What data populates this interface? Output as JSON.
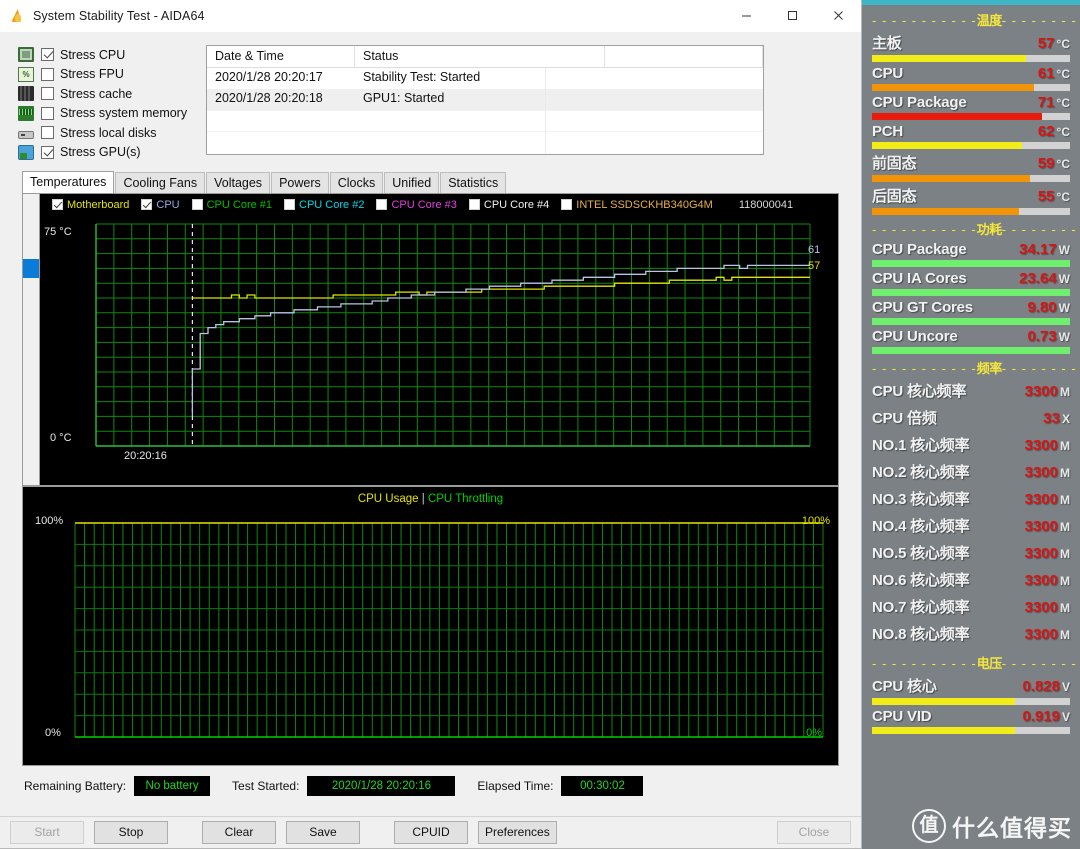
{
  "window": {
    "title": "System Stability Test - AIDA64",
    "icon": "flame-icon",
    "minimize_label": "minimize-icon",
    "maximize_label": "maximize-icon",
    "close_label": "close-icon"
  },
  "stress_options": [
    {
      "label": "Stress CPU",
      "checked": true,
      "icon": "cpu-chip-icon"
    },
    {
      "label": "Stress FPU",
      "checked": false,
      "icon": "fpu-percent-icon"
    },
    {
      "label": "Stress cache",
      "checked": false,
      "icon": "cache-icon"
    },
    {
      "label": "Stress system memory",
      "checked": false,
      "icon": "memory-stick-icon"
    },
    {
      "label": "Stress local disks",
      "checked": false,
      "icon": "hard-disk-icon"
    },
    {
      "label": "Stress GPU(s)",
      "checked": true,
      "icon": "gpu-card-icon"
    }
  ],
  "log_table": {
    "headers": [
      "Date & Time",
      "Status",
      ""
    ],
    "rows": [
      {
        "datetime": "2020/1/28 20:20:17",
        "status": "Stability Test: Started"
      },
      {
        "datetime": "2020/1/28 20:20:18",
        "status": "GPU1: Started"
      }
    ]
  },
  "tabs": [
    {
      "label": "Temperatures",
      "active": true
    },
    {
      "label": "Cooling Fans",
      "active": false
    },
    {
      "label": "Voltages",
      "active": false
    },
    {
      "label": "Powers",
      "active": false
    },
    {
      "label": "Clocks",
      "active": false
    },
    {
      "label": "Unified",
      "active": false
    },
    {
      "label": "Statistics",
      "active": false
    }
  ],
  "temp_chart": {
    "legend": [
      {
        "label": "Motherboard",
        "checked": true,
        "color": "#e3e300"
      },
      {
        "label": "CPU",
        "checked": true,
        "color": "#9aa6e0"
      },
      {
        "label": "CPU Core #1",
        "checked": false,
        "color": "#00c000"
      },
      {
        "label": "CPU Core #2",
        "checked": false,
        "color": "#00d8e8"
      },
      {
        "label": "CPU Core #3",
        "checked": false,
        "color": "#e040e0"
      },
      {
        "label": "CPU Core #4",
        "checked": false,
        "color": "#f0f0f0"
      },
      {
        "label": "INTEL SSDSCKHB340G4M",
        "checked": false,
        "color": "#e8b04a"
      }
    ],
    "serial": "118000041",
    "y_top": "75 °C",
    "y_bottom": "0 °C",
    "x_start": "20:20:16",
    "value_labels": [
      {
        "text": "61",
        "color": "#b9c3e6"
      },
      {
        "text": "57",
        "color": "#e3e300"
      }
    ]
  },
  "usage_chart": {
    "title_a": "CPU Usage",
    "title_sep": "|",
    "title_b": "CPU Throttling",
    "y_top_left": "100%",
    "y_top_right": "100%",
    "y_bottom_left": "0%",
    "y_bottom_right": "0%"
  },
  "status": {
    "battery_label": "Remaining Battery:",
    "battery_value": "No battery",
    "started_label": "Test Started:",
    "started_value": "2020/1/28 20:20:16",
    "elapsed_label": "Elapsed Time:",
    "elapsed_value": "00:30:02"
  },
  "buttons": [
    {
      "label": "Start",
      "disabled": true
    },
    {
      "label": "Stop",
      "disabled": false
    },
    {
      "label": "Clear",
      "disabled": false
    },
    {
      "label": "Save",
      "disabled": false
    },
    {
      "label": "CPUID",
      "disabled": false
    },
    {
      "label": "Preferences",
      "disabled": false
    },
    {
      "label": "Close",
      "disabled": true
    }
  ],
  "sidebar": {
    "sections": [
      {
        "title": "温度",
        "metrics": [
          {
            "name": "主板",
            "value": "57",
            "unit": "°C",
            "bar": 78,
            "color": "#f2ec19"
          },
          {
            "name": "CPU",
            "value": "61",
            "unit": "°C",
            "bar": 82,
            "color": "#f29407"
          },
          {
            "name": "CPU Package",
            "value": "71",
            "unit": "°C",
            "bar": 86,
            "color": "#e81b0d"
          },
          {
            "name": "PCH",
            "value": "62",
            "unit": "°C",
            "bar": 76,
            "color": "#f2ec19"
          },
          {
            "name": "前固态",
            "value": "59",
            "unit": "°C",
            "bar": 80,
            "color": "#f29407"
          },
          {
            "name": "后固态",
            "value": "55",
            "unit": "°C",
            "bar": 74,
            "color": "#f29407"
          }
        ]
      },
      {
        "title": "功耗",
        "metrics": [
          {
            "name": "CPU Package",
            "value": "34.17",
            "unit": "W",
            "bar": 100,
            "color": "#6ef06e"
          },
          {
            "name": "CPU IA Cores",
            "value": "23.64",
            "unit": "W",
            "bar": 100,
            "color": "#6ef06e"
          },
          {
            "name": "CPU GT Cores",
            "value": "9.80",
            "unit": "W",
            "bar": 100,
            "color": "#6ef06e"
          },
          {
            "name": "CPU Uncore",
            "value": "0.73",
            "unit": "W",
            "bar": 100,
            "color": "#6ef06e"
          }
        ]
      },
      {
        "title": "频率",
        "metrics": [
          {
            "name": "CPU 核心频率",
            "value": "3300",
            "unit": "M",
            "bar": -1
          },
          {
            "name": "CPU 倍频",
            "value": "33",
            "unit": "X",
            "bar": -1
          },
          {
            "name": "NO.1 核心频率",
            "value": "3300",
            "unit": "M",
            "bar": -1
          },
          {
            "name": "NO.2 核心频率",
            "value": "3300",
            "unit": "M",
            "bar": -1
          },
          {
            "name": "NO.3 核心频率",
            "value": "3300",
            "unit": "M",
            "bar": -1
          },
          {
            "name": "NO.4 核心频率",
            "value": "3300",
            "unit": "M",
            "bar": -1
          },
          {
            "name": "NO.5 核心频率",
            "value": "3300",
            "unit": "M",
            "bar": -1
          },
          {
            "name": "NO.6 核心频率",
            "value": "3300",
            "unit": "M",
            "bar": -1
          },
          {
            "name": "NO.7 核心频率",
            "value": "3300",
            "unit": "M",
            "bar": -1
          },
          {
            "name": "NO.8 核心频率",
            "value": "3300",
            "unit": "M",
            "bar": -1
          }
        ]
      },
      {
        "title": "电压",
        "metrics": [
          {
            "name": "CPU 核心",
            "value": "0.828",
            "unit": "V",
            "bar": 72,
            "color": "#f2ec19"
          },
          {
            "name": "CPU VID",
            "value": "0.919",
            "unit": "V",
            "bar": 72,
            "color": "#f2ec19"
          }
        ]
      }
    ]
  },
  "watermark": {
    "mark": "值",
    "text": "什么值得买"
  },
  "chart_data": {
    "type": "line",
    "title": "Temperatures",
    "xlabel": "",
    "ylabel": "°C",
    "ylim": [
      0,
      75
    ],
    "x_start_label": "20:20:16",
    "grid": true,
    "legend_position": "top",
    "series": [
      {
        "name": "Motherboard",
        "color": "#e3e300",
        "final_value": 57,
        "values": [
          50,
          50,
          50,
          50,
          50,
          51,
          50,
          51,
          50,
          50,
          50,
          50,
          50,
          50,
          50,
          50,
          50,
          50,
          51,
          51,
          51,
          51,
          51,
          51,
          51,
          51,
          52,
          52,
          52,
          51,
          52,
          52,
          52,
          52,
          52,
          52,
          52,
          53,
          53,
          53,
          53,
          53,
          53,
          53,
          53,
          54,
          54,
          54,
          54,
          54,
          54,
          54,
          54,
          54,
          55,
          55,
          55,
          55,
          55,
          55,
          55,
          56,
          56,
          56,
          56,
          56,
          56,
          57,
          56,
          57,
          57,
          57,
          57,
          57,
          57,
          57,
          57,
          57,
          57,
          57
        ]
      },
      {
        "name": "CPU",
        "color": "#b9c3e6",
        "final_value": 61,
        "values": [
          26,
          38,
          40,
          41,
          42,
          42,
          43,
          43,
          44,
          44,
          45,
          45,
          45,
          46,
          46,
          46,
          47,
          47,
          47,
          48,
          48,
          48,
          48,
          49,
          49,
          50,
          50,
          50,
          51,
          51,
          51,
          52,
          52,
          52,
          52,
          53,
          53,
          53,
          54,
          54,
          54,
          54,
          55,
          55,
          55,
          55,
          56,
          56,
          56,
          56,
          57,
          57,
          57,
          57,
          58,
          58,
          58,
          58,
          59,
          59,
          59,
          59,
          60,
          60,
          60,
          60,
          60,
          60,
          61,
          61,
          60,
          61,
          61,
          61,
          61,
          61,
          61,
          61,
          61,
          61
        ]
      }
    ],
    "secondary_chart": {
      "type": "line",
      "title": "CPU Usage | CPU Throttling",
      "ylim": [
        0,
        100
      ],
      "ylabel": "%",
      "series": [
        {
          "name": "CPU Usage",
          "color": "#e3e300",
          "constant_value": 100
        },
        {
          "name": "CPU Throttling",
          "color": "#00d000",
          "constant_value": 0
        }
      ]
    }
  }
}
